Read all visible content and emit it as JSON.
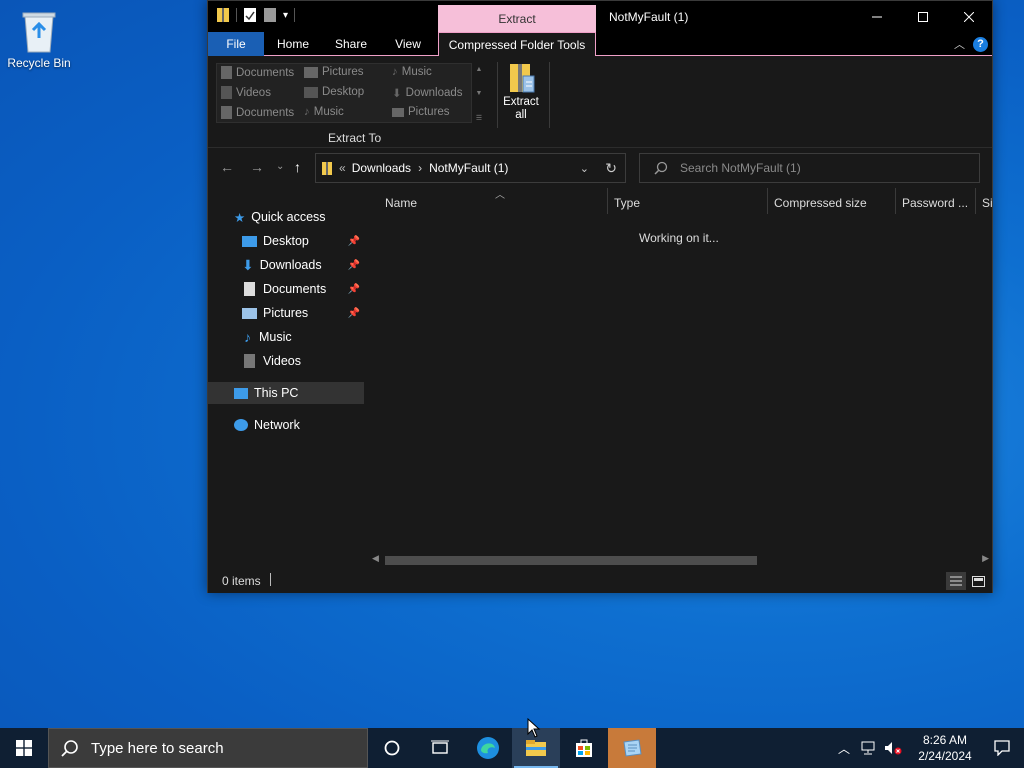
{
  "desktop": {
    "recycle_bin_label": "Recycle Bin"
  },
  "window": {
    "title": "NotMyFault (1)",
    "context_tab_label": "Extract",
    "tabs": [
      "File",
      "Home",
      "Share",
      "View",
      "Compressed Folder Tools"
    ],
    "active_tab": "Compressed Folder Tools",
    "ribbon": {
      "gallery": [
        "Documents",
        "Pictures",
        "Music",
        "Videos",
        "Desktop",
        "Downloads",
        "Documents",
        "Music",
        "Pictures"
      ],
      "group_label": "Extract To",
      "extract_all_line1": "Extract",
      "extract_all_line2": "all"
    },
    "address": {
      "overflow": "«",
      "path": [
        "Downloads",
        "NotMyFault (1)"
      ]
    },
    "search_placeholder": "Search NotMyFault (1)",
    "sidebar": {
      "quick_access": "Quick access",
      "pinned": [
        "Desktop",
        "Downloads",
        "Documents",
        "Pictures"
      ],
      "unpinned": [
        "Music",
        "Videos"
      ],
      "this_pc": "This PC",
      "network": "Network"
    },
    "columns": [
      "Name",
      "Type",
      "Compressed size",
      "Password ...",
      "Si"
    ],
    "status_message": "Working on it...",
    "item_count": "0 items"
  },
  "taskbar": {
    "search_placeholder": "Type here to search",
    "time": "8:26 AM",
    "date": "2/24/2024"
  },
  "colors": {
    "context_tab_bg": "#f6bfd9",
    "file_tab_bg": "#1a5fb4",
    "window_bg": "#191919",
    "taskbar_bg": "#0f1f33"
  }
}
